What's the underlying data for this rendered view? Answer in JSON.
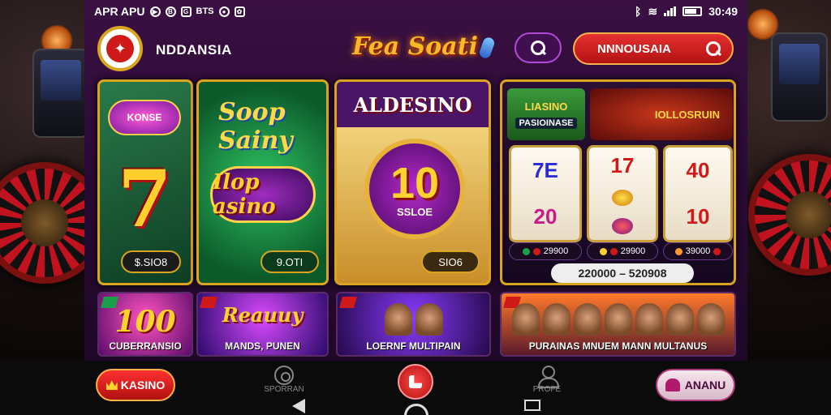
{
  "status_bar": {
    "left_text": "APR APU",
    "time": "30:49",
    "icons": [
      "media-icon",
      "circle-icon",
      "notification-icon",
      "bitcoin-icon",
      "location-icon",
      "settings-icon"
    ],
    "small_labels": [
      "B",
      "G",
      "BTS"
    ]
  },
  "header": {
    "brand_name": "NDDANSIA",
    "title_logo": "Fea Soati",
    "search_field_value": "NNNOUSAIA"
  },
  "cards": [
    {
      "badge": "KONSE",
      "symbol": "7",
      "price": "$.SIO8"
    },
    {
      "badge": "Soop Sainy",
      "title": "Ilop asino",
      "price": "9.OTI"
    },
    {
      "badge": "ALDESINO",
      "number": "10",
      "sub": "SSLOE",
      "price": "SIO6"
    },
    {
      "badge_left": "LIASINO",
      "badge_left_sub": "PASIOINASE",
      "badge_right": "IOLLOSRUIN",
      "reels": [
        {
          "top": "7E",
          "bottom": "20"
        },
        {
          "top": "17",
          "bottom": ""
        },
        {
          "top": "40",
          "bottom": "10"
        }
      ],
      "chips": [
        "29900",
        "29900",
        "39000"
      ],
      "range": "220000 – 520908"
    }
  ],
  "tiles": [
    {
      "head": "100",
      "label": "CUBERRANSIO"
    },
    {
      "head": "Reauuy",
      "label": "MANDS, PUNEN"
    },
    {
      "label": "LOERNF MULTIPAIN"
    },
    {
      "label": "PURAINAS MNUEM MANN MULTANUS"
    }
  ],
  "bottom_nav": {
    "kasino_label": "KASINO",
    "item1_label": "SPORRAN",
    "item2_label": "PROFE",
    "profile_label": "ANANU"
  },
  "colors": {
    "accent_red": "#d01a1a",
    "gold": "#d9a520",
    "purple_bg": "#2a0a34"
  }
}
